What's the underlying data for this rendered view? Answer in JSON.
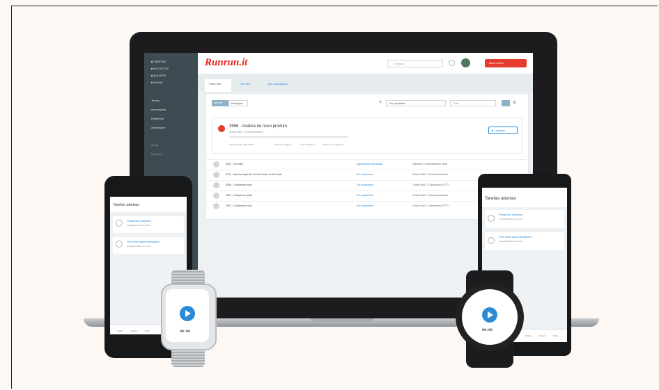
{
  "app": {
    "brand": "Runrun.it",
    "search_placeholder": "Q  Busca",
    "new_task_label": "Nova tarefa"
  },
  "sidebar": {
    "items": [
      {
        "label": "■  TAREFAS"
      },
      {
        "label": "■  PROJETOS"
      },
      {
        "label": "■  EQUIPES"
      },
      {
        "label": "■  MURAL"
      },
      {
        "label": "Tempo"
      },
      {
        "label": "Aprovações"
      },
      {
        "label": "Relatórios"
      },
      {
        "label": "Administrar"
      },
      {
        "label": "Ajuda"
      },
      {
        "label": "Pessoas"
      }
    ]
  },
  "tabs": [
    "Para mim",
    "Por mim",
    "Que acompanho"
  ],
  "filters": {
    "toggle_a": "Abertas",
    "toggle_b": "Entregues",
    "sort_value": "Por prioridade",
    "filter_placeholder": "Filtro"
  },
  "current_task": {
    "title": "3556 - Análise de novo produto",
    "subtitle": "Cliente ABC > Desenvolvimento",
    "play_label": "▶  Trabalhar",
    "meta": [
      "Data entregue: 25/11/2015",
      "Gerência: Ongoing",
      "Tipo: Marketing",
      "Status: Em andamento"
    ]
  },
  "task_rows": [
    {
      "title": "3357 - Reunião",
      "status": "Aguardando aprovação",
      "client": "Elanticus > Administrativo ideal"
    },
    {
      "title": "3341 - Apresentação de Novos Dados de Mercado",
      "status": "Em andamento",
      "client": "Cliente ABC > Desenvolvimento"
    },
    {
      "title": "3556 - Campanha novo",
      "status": "Em andamento",
      "client": "Cliente ABC > Campanha XPTO"
    },
    {
      "title": "3502 - Criação de posts",
      "status": "Em andamento",
      "client": "Cliente ABC > Desenvolvimento"
    },
    {
      "title": "3361 - Campanha novo",
      "status": "Em andamento",
      "client": "Cliente ABC > Campanha XPTO"
    }
  ],
  "mobile": {
    "title": "Tarefas abertas",
    "cards": [
      {
        "title": "Pesquisar imagens",
        "sub": "Campanha Blue em Novo"
      },
      {
        "title": "Tirar fotos para campanha",
        "sub": "Campanha Blue em Novo"
      }
    ],
    "nav": [
      "Tarefas",
      "Equipes",
      "Mural"
    ]
  },
  "watch": {
    "time": "00:00"
  }
}
